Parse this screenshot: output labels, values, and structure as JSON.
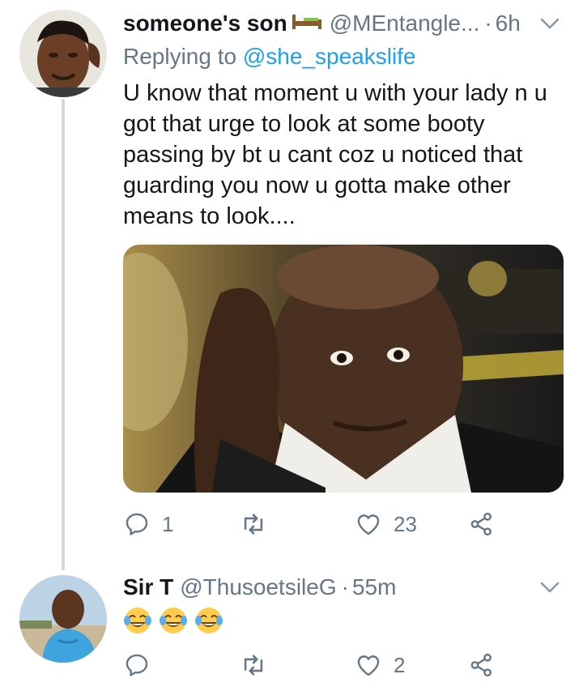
{
  "tweet1": {
    "display_name": "someone's son",
    "name_emoji": "bed-emoji",
    "handle": "@MEntangle...",
    "dot": "·",
    "time": "6h",
    "replying_prefix": "Replying to ",
    "replying_mention": "@she_speakslife",
    "text": "U know that moment u with your lady n u\ngot that urge to look at some booty\npassing by bt u cant coz u noticed that\nguarding you now u gotta make other\nmeans to look....",
    "actions": {
      "reply_count": "1",
      "retweet_count": "",
      "like_count": "23"
    }
  },
  "tweet2": {
    "display_name": "Sir T",
    "handle": "@ThusoetsileG",
    "dot": "·",
    "time": "55m",
    "emojis": [
      "face-with-tears-of-joy",
      "face-with-tears-of-joy",
      "face-with-tears-of-joy"
    ],
    "actions": {
      "reply_count": "",
      "retweet_count": "",
      "like_count": "2"
    }
  },
  "colors": {
    "text": "#14171a",
    "secondary": "#657786",
    "link": "#1da1f2",
    "thread_line": "#cfd9de"
  },
  "icons": [
    "chevron-down-icon",
    "reply-icon",
    "retweet-icon",
    "like-icon",
    "share-icon"
  ]
}
